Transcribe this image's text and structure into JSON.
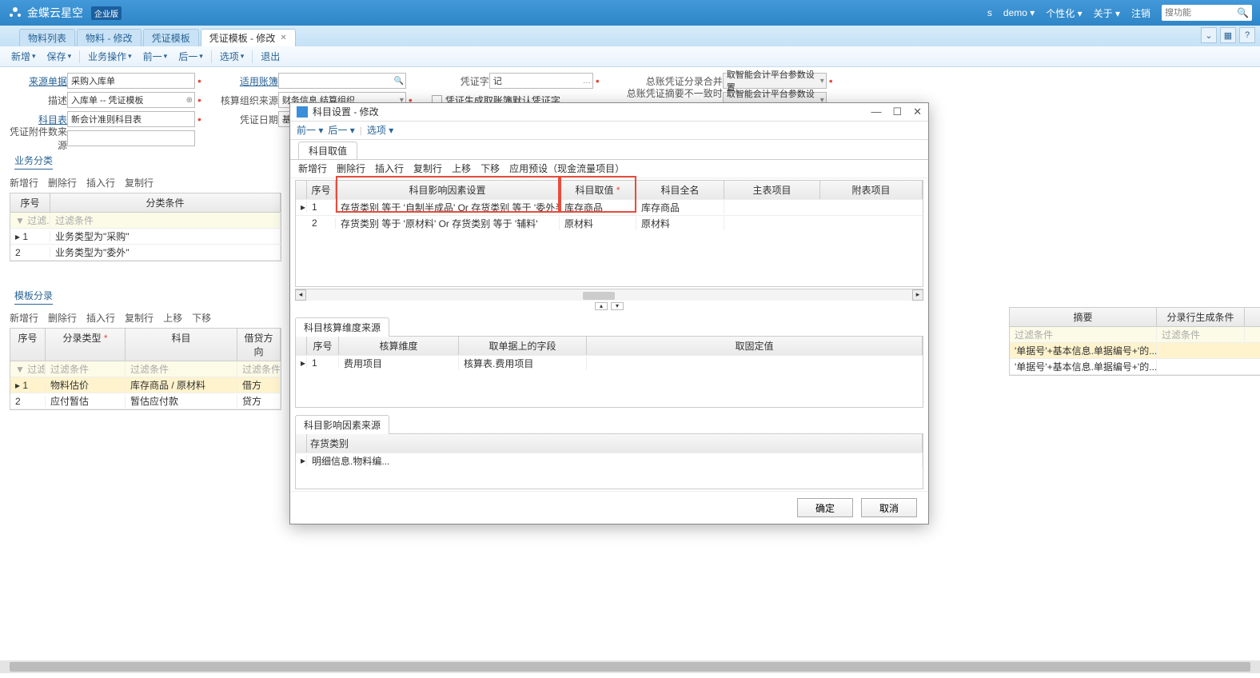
{
  "header": {
    "brand": "金蝶云星空",
    "edition": "企业版",
    "user": "s",
    "org": "demo",
    "menus": [
      "个性化",
      "关于"
    ],
    "logout": "注销",
    "search_placeholder": "搜功能"
  },
  "tabs": {
    "items": [
      "物料列表",
      "物料 - 修改",
      "凭证模板",
      "凭证模板 - 修改"
    ],
    "active_index": 3
  },
  "toolbar": {
    "items": [
      "新增",
      "保存",
      "业务操作",
      "前一",
      "后一",
      "选项",
      "退出"
    ]
  },
  "form": {
    "source_bill_label": "来源单据",
    "source_bill": "采购入库单",
    "desc_label": "描述",
    "desc": "入库单 -- 凭证模板",
    "subject_table_label": "科目表",
    "subject_table": "新会计准则科目表",
    "attach_label": "凭证附件数来源",
    "applicable_label": "适用账簿",
    "org_src_label": "核算组织来源",
    "org_src": "财务信息.结算组织",
    "voucher_date_label": "凭证日期",
    "voucher_date": "基",
    "voucher_word_label": "凭证字",
    "voucher_word": "记",
    "gen_default_label": "凭证生成取账簿默认凭证字",
    "gl_merge_label": "总账凭证分录合并",
    "gl_merge": "取智能会计平台参数设置",
    "gl_summary_label": "总账凭证摘要不一致时合并",
    "gl_summary": "取智能会计平台参数设置"
  },
  "biz_class": {
    "title": "业务分类",
    "toolbar": [
      "新增行",
      "删除行",
      "插入行",
      "复制行"
    ],
    "cols": [
      "序号",
      "分类条件"
    ],
    "filter": "过滤条件",
    "rows": [
      {
        "seq": "1",
        "cond": "业务类型为\"采购\""
      },
      {
        "seq": "2",
        "cond": "业务类型为\"委外\""
      }
    ]
  },
  "template_entry": {
    "title": "模板分录",
    "toolbar": [
      "新增行",
      "删除行",
      "插入行",
      "复制行",
      "上移",
      "下移"
    ],
    "cols": [
      "序号",
      "分录类型",
      "科目",
      "借贷方向"
    ],
    "filter": "过滤条件",
    "rows": [
      {
        "seq": "1",
        "type": "物料估价",
        "subj": "库存商品 / 原材料",
        "dir": "借方"
      },
      {
        "seq": "2",
        "type": "应付暂估",
        "subj": "暂估应付款",
        "dir": "贷方"
      }
    ]
  },
  "right_grid": {
    "cols": [
      "摘要",
      "分录行生成条件"
    ],
    "filter": "过滤条件",
    "rows": [
      "'单据号'+基本信息.单据编号+'的...",
      "'单据号'+基本信息.单据编号+'的..."
    ]
  },
  "modal": {
    "title": "科目设置 - 修改",
    "nav": [
      "前一",
      "后一",
      "选项"
    ],
    "tab": "科目取值",
    "toolbar": [
      "新增行",
      "删除行",
      "插入行",
      "复制行",
      "上移",
      "下移",
      "应用预设（现金流量项目）"
    ],
    "grid": {
      "cols": [
        "序号",
        "科目影响因素设置",
        "科目取值",
        "科目全名",
        "主表项目",
        "附表项目"
      ],
      "rows": [
        {
          "seq": "1",
          "factor": "存货类别  等于  '自制半成品'   Or    存货类别  等于  '委外半...",
          "val": "库存商品",
          "full": "库存商品"
        },
        {
          "seq": "2",
          "factor": "存货类别  等于  '原材料'   Or    存货类别  等于  '辅料'",
          "val": "原材料",
          "full": "原材料"
        }
      ]
    },
    "dim_src": {
      "title": "科目核算维度来源",
      "cols": [
        "序号",
        "核算维度",
        "取单据上的字段",
        "取固定值"
      ],
      "rows": [
        {
          "seq": "1",
          "dim": "费用项目",
          "field": "核算表.费用项目",
          "fixed": ""
        }
      ]
    },
    "factor_src": {
      "title": "科目影响因素来源",
      "col": "存货类别",
      "row": "明细信息.物料编..."
    },
    "ok": "确定",
    "cancel": "取消"
  }
}
